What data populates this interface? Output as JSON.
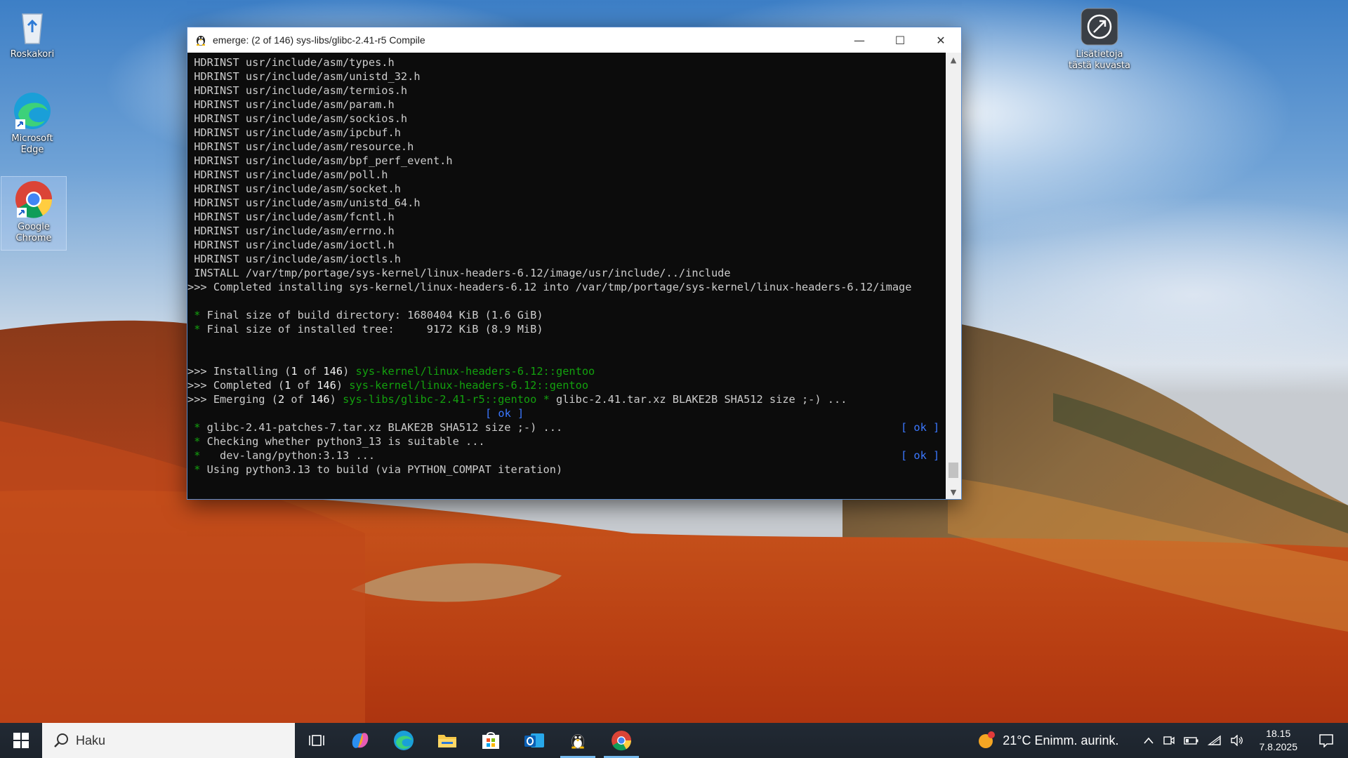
{
  "desktop": {
    "icons": [
      {
        "label": "Roskakori"
      },
      {
        "label": "Microsoft Edge"
      },
      {
        "label": "Google Chrome"
      },
      {
        "label": "Lisätietoja tästä kuvasta"
      }
    ]
  },
  "window": {
    "title": "emerge: (2 of 146) sys-libs/glibc-2.41-r5 Compile",
    "minimize": "—",
    "maximize": "☐",
    "close": "✕"
  },
  "terminal": {
    "hdrinst": [
      " HDRINST usr/include/asm/types.h",
      " HDRINST usr/include/asm/unistd_32.h",
      " HDRINST usr/include/asm/termios.h",
      " HDRINST usr/include/asm/param.h",
      " HDRINST usr/include/asm/sockios.h",
      " HDRINST usr/include/asm/ipcbuf.h",
      " HDRINST usr/include/asm/resource.h",
      " HDRINST usr/include/asm/bpf_perf_event.h",
      " HDRINST usr/include/asm/poll.h",
      " HDRINST usr/include/asm/socket.h",
      " HDRINST usr/include/asm/unistd_64.h",
      " HDRINST usr/include/asm/fcntl.h",
      " HDRINST usr/include/asm/errno.h",
      " HDRINST usr/include/asm/ioctl.h",
      " HDRINST usr/include/asm/ioctls.h"
    ],
    "install_line": " INSTALL /var/tmp/portage/sys-kernel/linux-headers-6.12/image/usr/include/../include",
    "completed_install": ">>> Completed installing sys-kernel/linux-headers-6.12 into /var/tmp/portage/sys-kernel/linux-headers-6.12/image",
    "star": " *",
    "final_build": " Final size of build directory: 1680404 KiB (1.6 GiB)",
    "final_tree": " Final size of installed tree:     9172 KiB (8.9 MiB)",
    "installing_prefix": ">>> Installing (",
    "installing_n": "1",
    "installing_of": " of ",
    "installing_total": "146",
    "installing_close": ") ",
    "installing_pkg": "sys-kernel/linux-headers-6.12::gentoo",
    "completed_prefix": ">>> Completed (",
    "completed_n": "1",
    "completed_of": " of ",
    "completed_total": "146",
    "completed_close": ") ",
    "completed_pkg": "sys-kernel/linux-headers-6.12::gentoo",
    "emerging_prefix": ">>> Emerging (",
    "emerging_n": "2",
    "emerging_of": " of ",
    "emerging_total": "146",
    "emerging_close": ") ",
    "emerging_pkg": "sys-libs/glibc-2.41-r5::gentoo",
    "emerging_rest": " glibc-2.41.tar.xz BLAKE2B SHA512 size ;-) ...",
    "ok_label": "[ ok ]",
    "patches_line": " glibc-2.41-patches-7.tar.xz BLAKE2B SHA512 size ;-) ...",
    "checking_line": " Checking whether python3_13 is suitable ...",
    "devlang_line": "   dev-lang/python:3.13 ...",
    "using_line": " Using python3.13 to build (via PYTHON_COMPAT iteration)"
  },
  "taskbar": {
    "search_label": "Haku",
    "weather": "21°C  Enimm. aurink.",
    "time": "18.15",
    "date": "7.8.2025"
  },
  "colors": {
    "terminal_bg": "#0c0c0c",
    "terminal_text": "#cccccc",
    "green": "#13a10e",
    "ok_blue": "#3b78ff",
    "taskbar_bg": "#1f2833"
  }
}
